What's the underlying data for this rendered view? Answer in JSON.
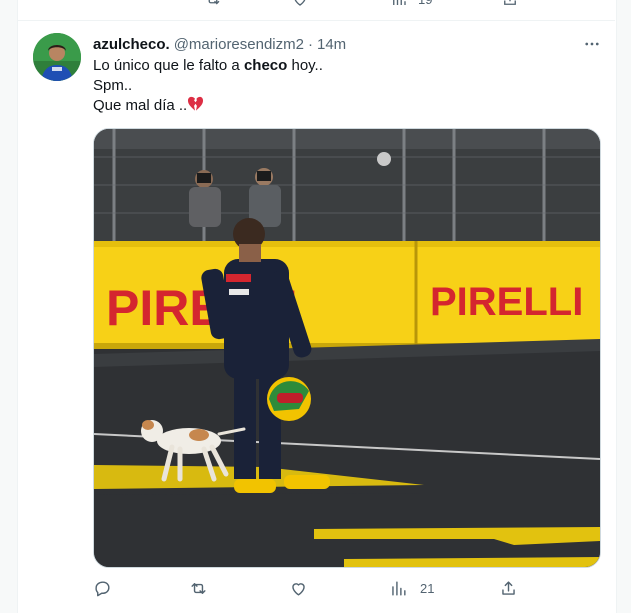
{
  "previous_tweet": {
    "views_count": "19"
  },
  "tweet": {
    "display_name": "azulcheco.",
    "handle": "@marioresendizm2",
    "separator": "·",
    "time": "14m",
    "text_line1_pre": "Lo único que le falto a ",
    "text_line1_bold": "checo",
    "text_line1_post": " hoy..",
    "text_line2": "Spm..",
    "text_line3": "Que mal día ..",
    "media_banner_text": "PIRELLI",
    "actions": {
      "reply_count": "",
      "retweet_count": "",
      "like_count": "",
      "views_count": "21"
    }
  },
  "icons": [
    "more-icon",
    "reply-icon",
    "retweet-icon",
    "like-icon",
    "views-icon",
    "share-icon",
    "broken-heart-icon"
  ],
  "colors": {
    "text": "#0f1419",
    "secondary": "#536471",
    "border": "#eff3f4",
    "banner_yellow": "#f7d117",
    "banner_red": "#d4262f"
  }
}
